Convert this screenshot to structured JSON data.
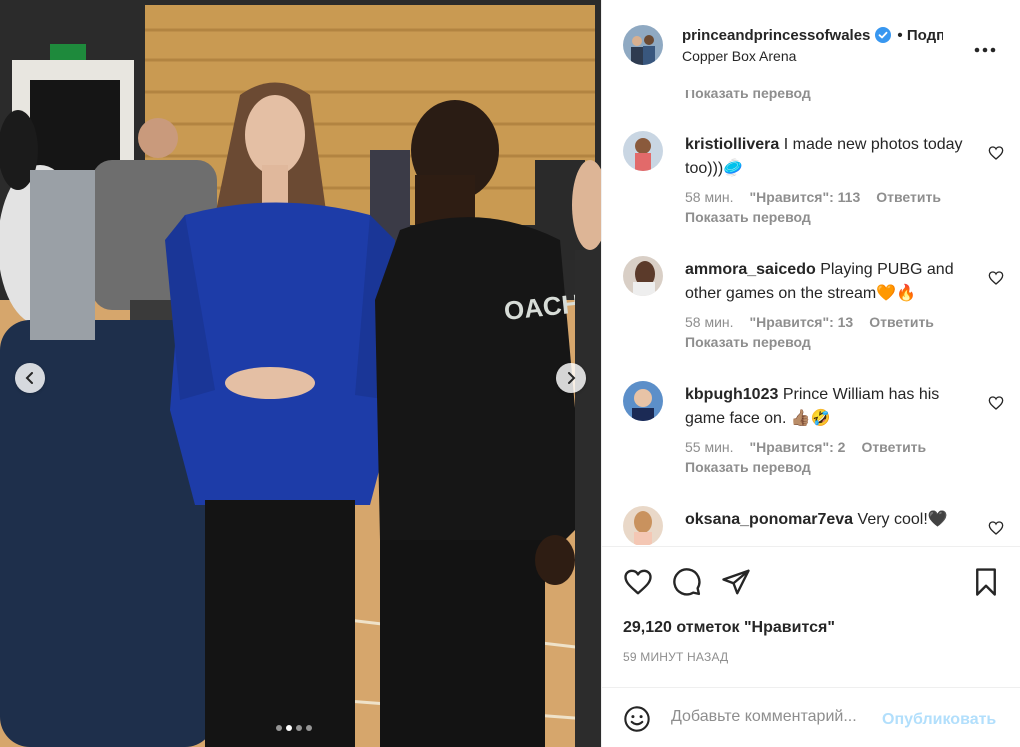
{
  "post": {
    "username": "princeandprincessofwales",
    "follow_label": "• Подписаться",
    "location": "Copper Box Arena",
    "likes_text": "29,120 отметок \"Нравится\"",
    "time_ago": "59 МИНУТ НАЗАД",
    "carousel": {
      "slides": 4,
      "active_index": 1
    }
  },
  "comments": {
    "top_translate": "Показать перевод",
    "items": [
      {
        "user": "kristiollivera",
        "text": "I made new photos today too)))",
        "emoji": "🥏",
        "time": "58 мин.",
        "likes": "\"Нравится\": 113",
        "reply": "Ответить",
        "translate": "Показать перевод"
      },
      {
        "user": "ammora_saicedo",
        "text": "Playing PUBG and other games on the stream",
        "emoji": "🧡🔥",
        "time": "58 мин.",
        "likes": "\"Нравится\": 13",
        "reply": "Ответить",
        "translate": "Показать перевод"
      },
      {
        "user": "kbpugh1023",
        "text": "Prince William has his game face on.",
        "emoji": "👍🏽🤣",
        "time": "55 мин.",
        "likes": "\"Нравится\": 2",
        "reply": "Ответить",
        "translate": "Показать перевод"
      },
      {
        "user": "oksana_ponomar7eva",
        "text": "Very cool!",
        "emoji": "🖤",
        "time": "",
        "likes": "",
        "reply": "",
        "translate": ""
      }
    ]
  },
  "add_comment": {
    "placeholder": "Добавьте комментарий...",
    "publish_label": "Опубликовать"
  },
  "icons": {
    "like": "heart-icon",
    "comment": "comment-icon",
    "share": "share-icon",
    "save": "bookmark-icon",
    "emoji": "smiley-icon",
    "more": "more-dots-icon",
    "verified": "verified-badge-icon"
  },
  "colors": {
    "verified": "#3897f0",
    "publish_disabled": "#b2dffc",
    "secondary_text": "#8e8e8e"
  }
}
